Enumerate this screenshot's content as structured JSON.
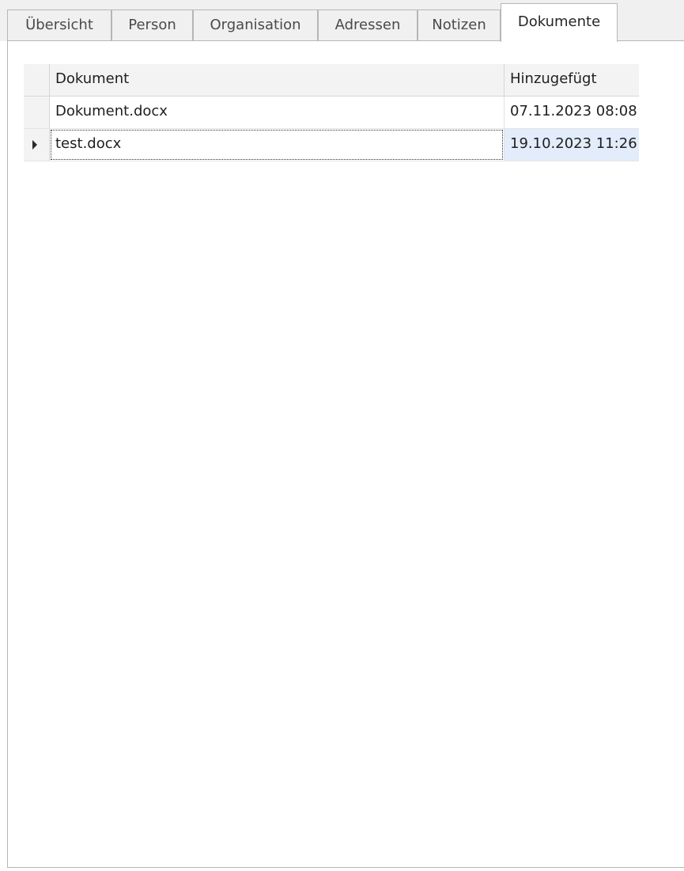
{
  "tabs": [
    {
      "label": "Übersicht",
      "active": false
    },
    {
      "label": "Person",
      "active": false
    },
    {
      "label": "Organisation",
      "active": false
    },
    {
      "label": "Adressen",
      "active": false
    },
    {
      "label": "Notizen",
      "active": false
    },
    {
      "label": "Dokumente",
      "active": true
    }
  ],
  "grid": {
    "columns": {
      "document": "Dokument",
      "added": "Hinzugefügt"
    },
    "rows": [
      {
        "document": "Dokument.docx",
        "added": "07.11.2023 08:08",
        "selected": false
      },
      {
        "document": "test.docx",
        "added": "19.10.2023 11:26",
        "selected": true
      }
    ],
    "selection_color": "#e3ecfa",
    "indicator_icon": "row-indicator-triangle-icon"
  }
}
